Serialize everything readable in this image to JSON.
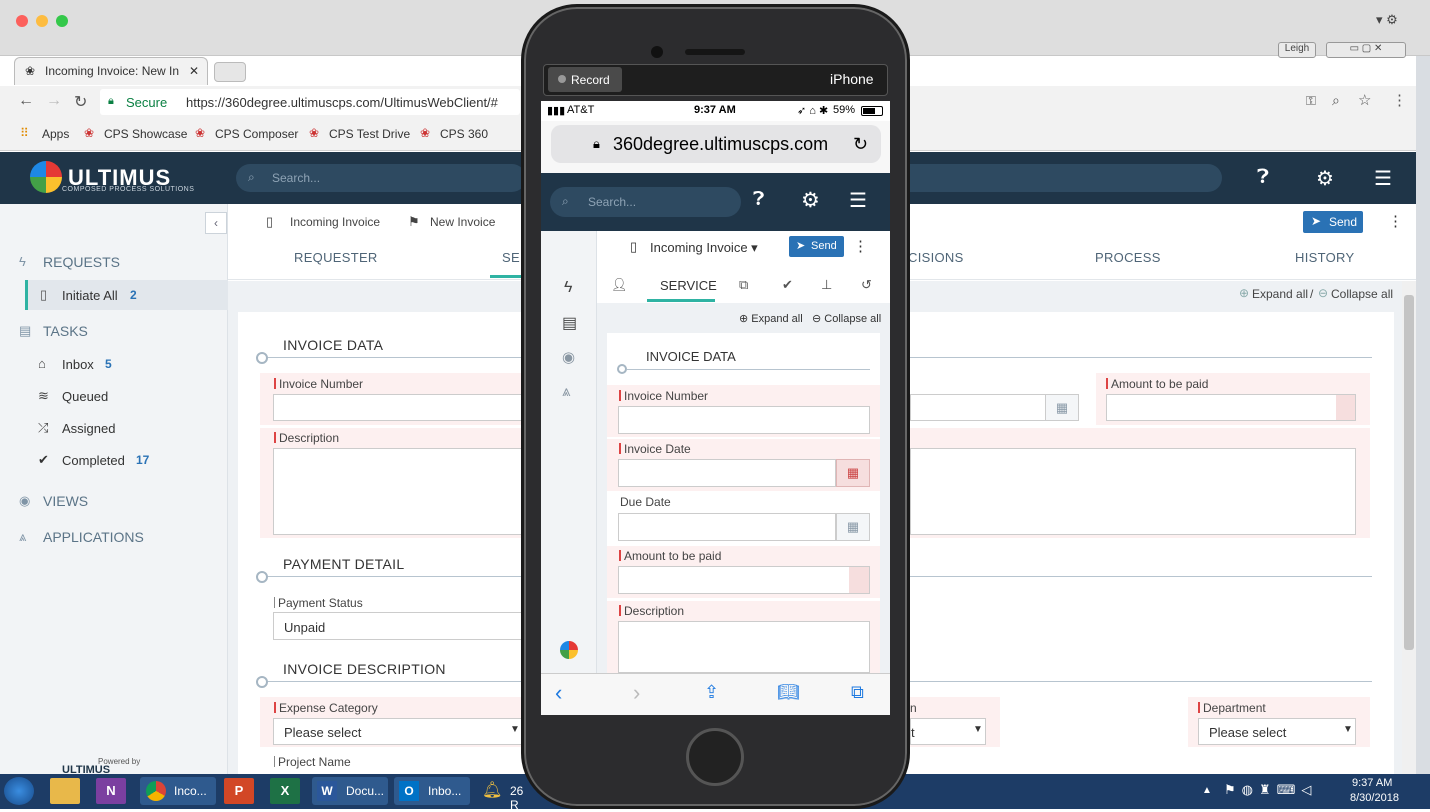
{
  "browser": {
    "tab_title": "Incoming Invoice: New In",
    "secure_label": "Secure",
    "url": "https://360degree.ultimuscps.com/UltimusWebClient/#",
    "user": "Leigh",
    "bookmarks": [
      {
        "label": "Apps"
      },
      {
        "label": "CPS Showcase"
      },
      {
        "label": "CPS Composer"
      },
      {
        "label": "CPS Test Drive"
      },
      {
        "label": "CPS 360"
      }
    ]
  },
  "app": {
    "logo": "ULTIMUS",
    "logo_sub": "COMPOSED PROCESS SOLUTIONS",
    "search_placeholder": "Search...",
    "breadcrumb": {
      "item1": "Incoming Invoice",
      "item2": "New Invoice"
    },
    "send_label": "Send",
    "tabs": [
      "REQUESTER",
      "SE",
      "CISIONS",
      "PROCESS",
      "HISTORY"
    ],
    "expand_all": "Expand all",
    "collapse_all": "Collapse all"
  },
  "sidebar": {
    "requests": "REQUESTS",
    "initiate_all": "Initiate All",
    "initiate_count": "2",
    "tasks": "TASKS",
    "inbox": "Inbox",
    "inbox_count": "5",
    "queued": "Queued",
    "assigned": "Assigned",
    "completed": "Completed",
    "completed_count": "17",
    "views": "VIEWS",
    "applications": "APPLICATIONS",
    "powered_by": "Powered by"
  },
  "form": {
    "invoice_data": "INVOICE DATA",
    "invoice_number": "Invoice Number",
    "amount_to_be_paid": "Amount to be paid",
    "description": "Description",
    "payment_detail": "PAYMENT DETAIL",
    "payment_status": "Payment Status",
    "payment_status_value": "Unpaid",
    "invoice_description": "INVOICE DESCRIPTION",
    "expense_category": "Expense Category",
    "please_select": "Please select",
    "department": "Department",
    "project_name": "Project Name",
    "partial_n": "n",
    "partial_t": "t"
  },
  "phone": {
    "record": "Record",
    "device": "iPhone",
    "carrier": "AT&T",
    "time": "9:37 AM",
    "battery": "59%",
    "url": "360degree.ultimuscps.com",
    "search_placeholder": "Search...",
    "title": "Incoming Invoice",
    "send": "Send",
    "service_tab": "SERVICE",
    "expand_all": "Expand all",
    "collapse_all": "Collapse all",
    "invoice_data": "INVOICE DATA",
    "invoice_number": "Invoice Number",
    "invoice_date": "Invoice Date",
    "due_date": "Due Date",
    "amount_to_be_paid": "Amount to be paid",
    "description": "Description"
  },
  "taskbar": {
    "chrome": "Inco...",
    "word": "Docu...",
    "outlook": "Inbo...",
    "notify": "26 R",
    "time": "9:37 AM",
    "date": "8/30/2018"
  }
}
